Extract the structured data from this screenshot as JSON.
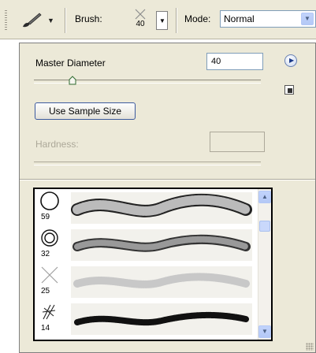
{
  "toolbar": {
    "tool_icon": "brush-tool-icon",
    "brush_label": "Brush:",
    "brush_size": "40",
    "mode_label": "Mode:",
    "mode_value": "Normal"
  },
  "panel": {
    "master_diameter_label": "Master Diameter",
    "master_diameter_value": "40",
    "use_sample_size_label": "Use Sample Size",
    "hardness_label": "Hardness:",
    "hardness_value": ""
  },
  "presets": [
    {
      "size": "59",
      "kind": "hard-round"
    },
    {
      "size": "32",
      "kind": "ring"
    },
    {
      "size": "25",
      "kind": "soft-cross"
    },
    {
      "size": "14",
      "kind": "scatter"
    }
  ],
  "colors": {
    "panel_bg": "#ece9d8",
    "accent": "#7f9db9"
  }
}
